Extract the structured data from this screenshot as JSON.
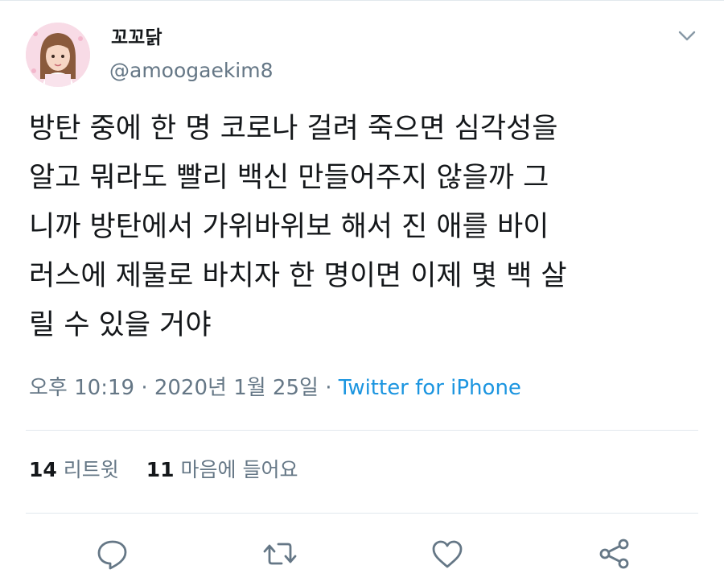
{
  "author": {
    "display_name": "꼬꼬닭",
    "handle": "@amoogaekim8"
  },
  "tweet": {
    "lines": [
      "방탄 중에 한 명 코로나 걸려 죽으면 심각성을",
      "알고 뭐라도 빨리 백신 만들어주지 않을까 그",
      "니까 방탄에서 가위바위보 해서 진 애를 바이",
      "러스에 제물로 바치자 한 명이면 이제 몇 백 살",
      "릴 수 있을 거야"
    ]
  },
  "meta": {
    "time": "오후 10:19",
    "separator": "·",
    "date": "2020년 1월 25일",
    "source": "Twitter for iPhone"
  },
  "stats": {
    "retweets_count": "14",
    "retweets_label": "리트윗",
    "likes_count": "11",
    "likes_label": "마음에 들어요"
  },
  "actions": {
    "icons": [
      "reply-icon",
      "retweet-icon",
      "like-icon",
      "share-icon"
    ]
  },
  "colors": {
    "link": "#1b95e0",
    "secondary_text": "#657786",
    "primary_text": "#14171a",
    "divider": "#e1e8ed"
  }
}
